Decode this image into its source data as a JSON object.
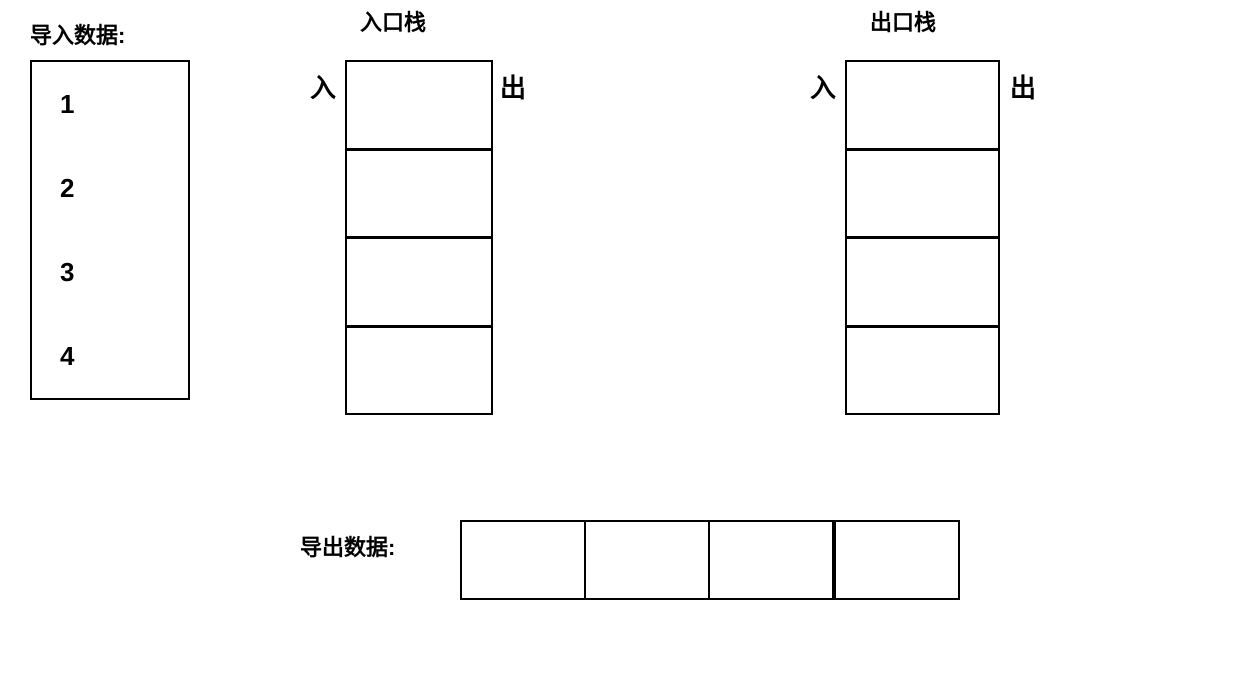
{
  "import": {
    "label": "导入数据:",
    "items": [
      "1",
      "2",
      "3",
      "4"
    ]
  },
  "entry_stack": {
    "label": "入口栈",
    "in_label": "入",
    "out_label": "出",
    "cells": 4
  },
  "exit_stack": {
    "label": "出口栈",
    "in_label": "入",
    "out_label": "出",
    "cells": 4
  },
  "export": {
    "label": "导出数据:",
    "cells": 4
  }
}
